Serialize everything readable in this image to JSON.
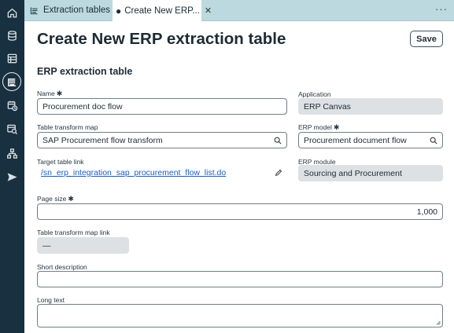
{
  "tabs": [
    {
      "label": "Extraction tables",
      "icon": "table-list-icon"
    },
    {
      "label": "Create New ERP...",
      "icon": "unsaved-dot-icon",
      "marker": "●"
    }
  ],
  "more_label": "···",
  "page": {
    "title": "Create New ERP extraction table",
    "save_label": "Save"
  },
  "section": {
    "title": "ERP extraction table"
  },
  "required_marker": "✱",
  "fields": {
    "name": {
      "label": "Name",
      "value": "Procurement doc flow"
    },
    "application": {
      "label": "Application",
      "value": "ERP Canvas"
    },
    "table_transform_map": {
      "label": "Table transform map",
      "value": "SAP Procurement flow transform"
    },
    "erp_model": {
      "label": "ERP model",
      "value": "Procurement document flow"
    },
    "target_table_link": {
      "label": "Target table link",
      "value": "/sn_erp_integration_sap_procurement_flow_list.do"
    },
    "erp_module": {
      "label": "ERP module",
      "value": "Sourcing and Procurement"
    },
    "page_size": {
      "label": "Page size",
      "value": "1,000"
    },
    "table_transform_map_link": {
      "label": "Table transform map link",
      "value": "—"
    },
    "short_description": {
      "label": "Short description",
      "value": ""
    },
    "long_text": {
      "label": "Long text",
      "value": ""
    }
  },
  "rail_icons": [
    "home-icon",
    "database-icon",
    "list-icon",
    "workspace-icon",
    "schedule-icon",
    "search-table-icon",
    "hierarchy-icon",
    "send-icon"
  ]
}
